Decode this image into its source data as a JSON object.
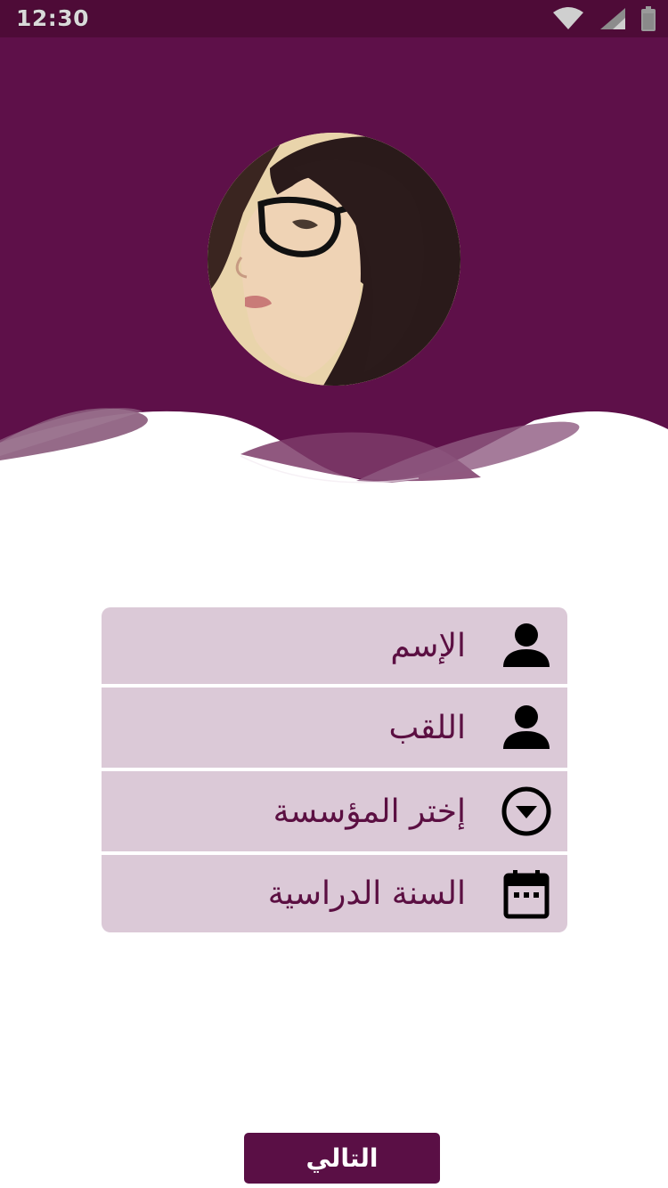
{
  "status_bar": {
    "time": "12:30",
    "icons": [
      "wifi-icon",
      "signal-icon",
      "battery-icon"
    ]
  },
  "colors": {
    "primary": "#5a0f45",
    "status_bar": "#4e0b37",
    "field_background": "#dbc9d7",
    "field_text": "#5b0f42",
    "button_text": "#ffffff"
  },
  "avatar": {
    "icon": "profile-photo"
  },
  "form": {
    "fields": [
      {
        "label": "الإسم",
        "icon": "person-icon"
      },
      {
        "label": "اللقب",
        "icon": "person-icon"
      },
      {
        "label": "إختر المؤسسة",
        "icon": "dropdown-circle-icon"
      },
      {
        "label": "السنة الدراسية",
        "icon": "calendar-icon"
      }
    ]
  },
  "next_button": {
    "label": "التالي"
  }
}
